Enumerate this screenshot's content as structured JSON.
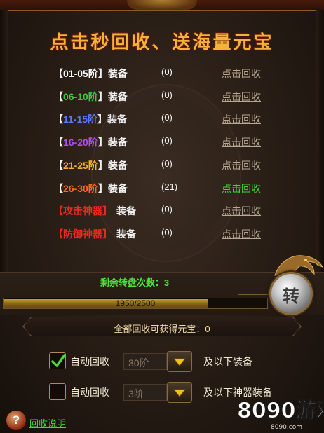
{
  "title": "点击秒回收、送海量元宝",
  "rows": [
    {
      "label": "01-05阶",
      "color": "#ffffff",
      "suffix": "装备",
      "count": "(0)",
      "action": "点击回收",
      "active": false
    },
    {
      "label": "06-10阶",
      "color": "#3ec93a",
      "suffix": "装备",
      "count": "(0)",
      "action": "点击回收",
      "active": false
    },
    {
      "label": "11-15阶",
      "color": "#5a78ff",
      "suffix": "装备",
      "count": "(0)",
      "action": "点击回收",
      "active": false
    },
    {
      "label": "16-20阶",
      "color": "#b04cf0",
      "suffix": "装备",
      "count": "(0)",
      "action": "点击回收",
      "active": false
    },
    {
      "label": "21-25阶",
      "color": "#f5b22a",
      "suffix": "装备",
      "count": "(0)",
      "action": "点击回收",
      "active": false
    },
    {
      "label": "26-30阶",
      "color": "#ff6a1a",
      "suffix": "装备",
      "count": "(21)",
      "action": "点击回收",
      "active": true
    },
    {
      "label": "攻击神器",
      "color": "#e82a20",
      "suffix": "装备",
      "count": "(0)",
      "action": "点击回收",
      "active": false
    },
    {
      "label": "防御神器",
      "color": "#e82a20",
      "suffix": "装备",
      "count": "(0)",
      "action": "点击回收",
      "active": false
    }
  ],
  "spins": {
    "label": "剩余转盘次数：3"
  },
  "progress": {
    "text": "1950/2500",
    "value": 1950,
    "max": 2500
  },
  "spin_button": {
    "label": "转"
  },
  "total_reward": "全部回收可获得元宝：0",
  "options": [
    {
      "checked": true,
      "label": "自动回收",
      "select_value": "30阶",
      "suffix": "及以下装备"
    },
    {
      "checked": false,
      "label": "自动回收",
      "select_value": "3阶",
      "suffix": "及以下神器装备"
    }
  ],
  "help": {
    "icon": "?",
    "link": "回收说明"
  },
  "brand": {
    "logo_text": "8090游戏",
    "logo_sub": "8090.com"
  },
  "colors": {
    "gold": "#f2b33a",
    "green": "#44d63a",
    "link_gray": "#b8a890"
  },
  "icons": {
    "check": "check-icon",
    "dropdown": "triangle-down-icon",
    "help": "question-icon"
  }
}
